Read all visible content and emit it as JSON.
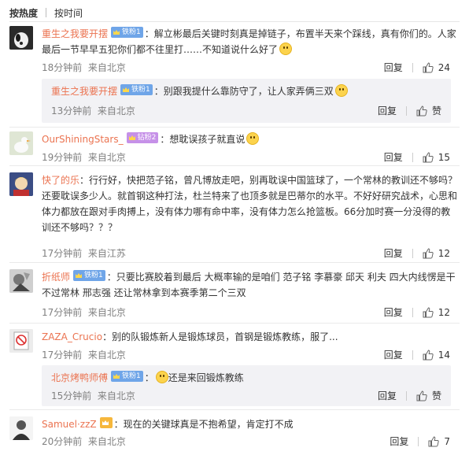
{
  "tabs": {
    "hot": "按热度",
    "time": "按时间"
  },
  "comments": [
    {
      "user": "重生之我要开摆",
      "badge": "铁粉1",
      "text": "：解立彬最后关键时刻真是掉链子，布置半天来个踩线，真有你们的。人家最后一节早早五犯你们都不往里打……不知道说什么好了",
      "time": "18分钟前",
      "loc": "来自北京",
      "reply": "回复",
      "likes": "24",
      "sub": {
        "user": "重生之我要开摆",
        "badge": "铁粉1",
        "text": "：别跟我提什么靠防守了，让人家弄俩三双",
        "time": "13分钟前",
        "loc": "来自北京",
        "reply": "回复",
        "likes": "赞"
      }
    },
    {
      "user": "OurShiningStars_",
      "badge": "钻粉2",
      "text": "：想耽误孩子就直说",
      "time": "19分钟前",
      "loc": "来自北京",
      "reply": "回复",
      "likes": "15"
    },
    {
      "user": "快了的乐",
      "text": "：行行好，快把范子铭，曾凡博放走吧，别再耽误中国篮球了，一个常林的教训还不够吗？还要耽误多少人。就首钢这种打法，杜兰特来了也顶多就是巴蒂尔的水平。不好好研究战术，心思和体力都放在跟对手肉搏上，没有体力哪有命中率，没有体力怎么抢篮板。66分加时赛一分没得的教训还不够吗？？？",
      "time": "17分钟前",
      "loc": "来自江苏",
      "reply": "回复",
      "likes": "12"
    },
    {
      "user": "折纸师",
      "badge": "铁粉1",
      "text": "：只要比赛胶着到最后 大概率输的是咱们 范子铭 李慕豪 邱天 利夫 四大内线愣是干不过常林 邢志强 还让常林拿到本赛季第二个三双",
      "time": "17分钟前",
      "loc": "来自北京",
      "reply": "回复",
      "likes": "12"
    },
    {
      "user": "ZAZA_Crucio",
      "text": "：别的队锻炼新人是锻炼球员，首钢是锻炼教练，服了...",
      "time": "17分钟前",
      "loc": "来自北京",
      "reply": "回复",
      "likes": "14",
      "sub": {
        "user": "北京烤鸭师傅",
        "badge": "铁粉1",
        "text": "还是来回锻炼教练",
        "time": "15分钟前",
        "loc": "来自北京",
        "reply": "回复",
        "likes": "赞"
      }
    },
    {
      "user": "Samuel·zzZ",
      "text": "：现在的关键球真是不抱希望，肯定打不成",
      "time": "20分钟前",
      "loc": "来自北京",
      "reply": "回复",
      "likes": "7"
    }
  ]
}
